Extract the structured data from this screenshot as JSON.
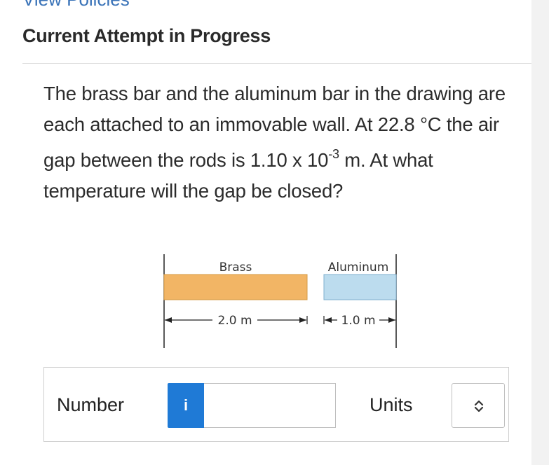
{
  "header": {
    "view_policies_link": "View Policies",
    "attempt_title": "Current Attempt in Progress"
  },
  "question": {
    "text_part1": "The brass bar and the aluminum bar in the drawing are each attached to an immovable wall. At 22.8 °C the air gap between the rods is 1.10 x 10",
    "exponent": "-3",
    "text_part2": " m. At what temperature will the gap be closed?"
  },
  "figure": {
    "brass_label": "Brass",
    "aluminum_label": "Aluminum",
    "brass_length": "2.0 m",
    "aluminum_length": "1.0 m",
    "colors": {
      "brass": "#f2b565",
      "aluminum": "#bcdcee"
    }
  },
  "answer": {
    "number_label": "Number",
    "info_icon": "i",
    "number_value": "",
    "units_label": "Units",
    "units_selected": ""
  }
}
